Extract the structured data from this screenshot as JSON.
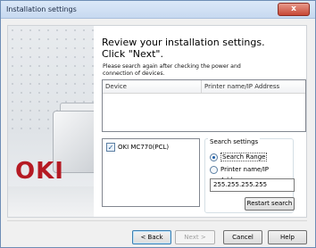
{
  "window": {
    "title": "Installation settings",
    "close_label": "x"
  },
  "art": {
    "brand": "OKI"
  },
  "main": {
    "heading_line1": "Review your installation settings.",
    "heading_line2": "Click \"Next\".",
    "hint_line1": "Please search again after checking the power and",
    "hint_line2": "connection of devices."
  },
  "device_table": {
    "columns": [
      "Device",
      "Printer name/IP Address"
    ],
    "rows": []
  },
  "printer_list": {
    "items": [
      {
        "label": "OKI MC770(PCL)",
        "checked": true
      }
    ]
  },
  "search_settings": {
    "title": "Search settings",
    "option_range": "Search Range",
    "option_ip": "Printer name/IP Address",
    "selected": "Search Range",
    "range_value": "255.255.255.255",
    "restart_label": "Restart search"
  },
  "footer": {
    "back_label": "< Back",
    "next_label": "Next >",
    "cancel_label": "Cancel",
    "help_label": "Help"
  },
  "colors": {
    "brand_red": "#b51a23",
    "title_bar": "#c7d9f0",
    "close_button": "#c74735"
  }
}
